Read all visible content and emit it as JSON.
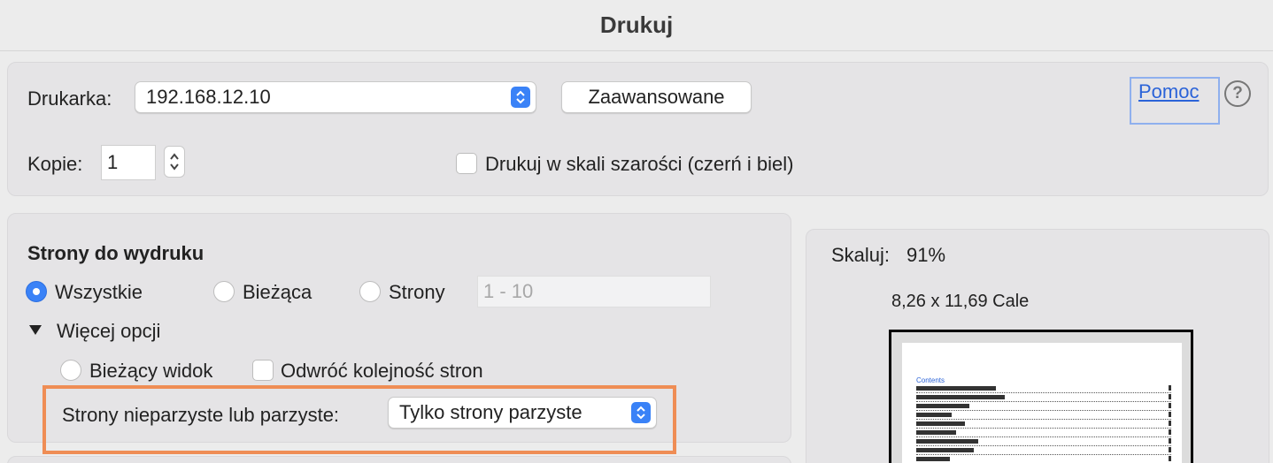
{
  "dialog": {
    "title": "Drukuj"
  },
  "printer": {
    "label": "Drukarka:",
    "selected": "192.168.12.10",
    "advanced_button": "Zaawansowane",
    "help_link": "Pomoc",
    "help_icon_glyph": "?"
  },
  "copies": {
    "label": "Kopie:",
    "value": "1",
    "grayscale_label": "Drukuj w skali szarości (czerń i biel)",
    "grayscale_checked": false
  },
  "pages": {
    "heading": "Strony do wydruku",
    "options": [
      {
        "label": "Wszystkie",
        "checked": true
      },
      {
        "label": "Bieżąca",
        "checked": false
      },
      {
        "label": "Strony",
        "checked": false
      }
    ],
    "range_placeholder": "1 - 10",
    "more_options_label": "Więcej opcji",
    "current_view_label": "Bieżący widok",
    "reverse_order_label": "Odwróć kolejność stron",
    "odd_even_label": "Strony nieparzyste lub parzyste:",
    "odd_even_selected": "Tylko strony parzyste"
  },
  "preview": {
    "scale_label": "Skaluj:",
    "scale_value": "91%",
    "paper_size": "8,26 x 11,69 Cale",
    "page_contents_title": "Contents"
  },
  "colors": {
    "accent": "#3a82f7",
    "highlight": "#ef8d55",
    "link": "#2b63d8"
  },
  "icons": [
    "popup-arrows-icon",
    "stepper-arrows-icon",
    "help-icon",
    "disclosure-triangle-icon"
  ]
}
